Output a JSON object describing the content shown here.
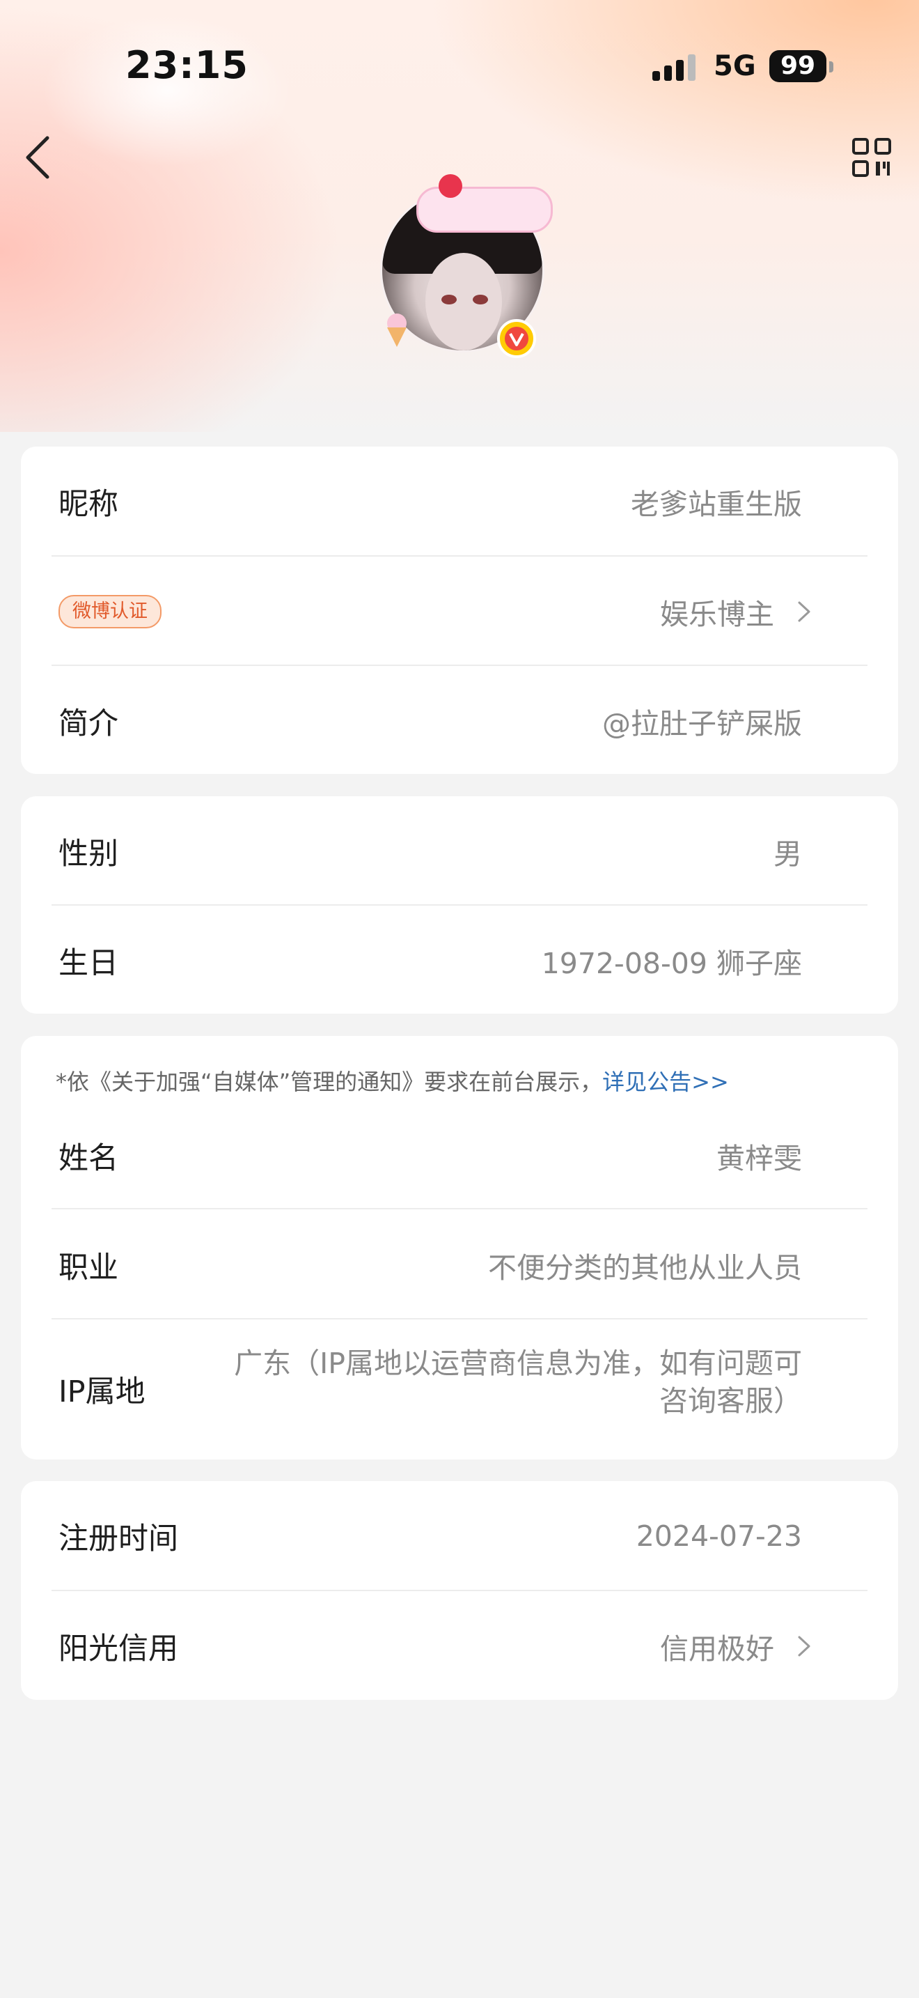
{
  "status_bar": {
    "time": "23:15",
    "network": "5G",
    "battery": "99"
  },
  "nav": {
    "back_icon": "chevron-left-icon",
    "qr_icon": "qr-code-icon"
  },
  "avatar": {
    "badge": "V"
  },
  "basic_info": {
    "nickname": {
      "label": "昵称",
      "value": "老爹站重生版"
    },
    "certification": {
      "badge": "微博认证",
      "value": "娱乐博主"
    },
    "bio": {
      "label": "简介",
      "value": "@拉肚子铲屎版"
    }
  },
  "personal": {
    "gender": {
      "label": "性别",
      "value": "男"
    },
    "birthday": {
      "label": "生日",
      "value": "1972-08-09 狮子座"
    }
  },
  "disclosure": {
    "notice": "*依《关于加强“自媒体”管理的通知》要求在前台展示，",
    "notice_link": "详见公告>>",
    "name": {
      "label": "姓名",
      "value": "黄梓雯"
    },
    "occupation": {
      "label": "职业",
      "value": "不便分类的其他从业人员"
    },
    "ip": {
      "label": "IP属地",
      "value_line1": "广东（IP属地以运营商信息为准，如有问题可",
      "value_line2": "咨询客服）"
    }
  },
  "account": {
    "register": {
      "label": "注册时间",
      "value": "2024-07-23"
    },
    "credit": {
      "label": "阳光信用",
      "value": "信用极好"
    }
  },
  "colors": {
    "accent_link": "#2f6fb6",
    "badge_orange": "#e15a2b",
    "verified_yellow": "#ffcb05"
  }
}
